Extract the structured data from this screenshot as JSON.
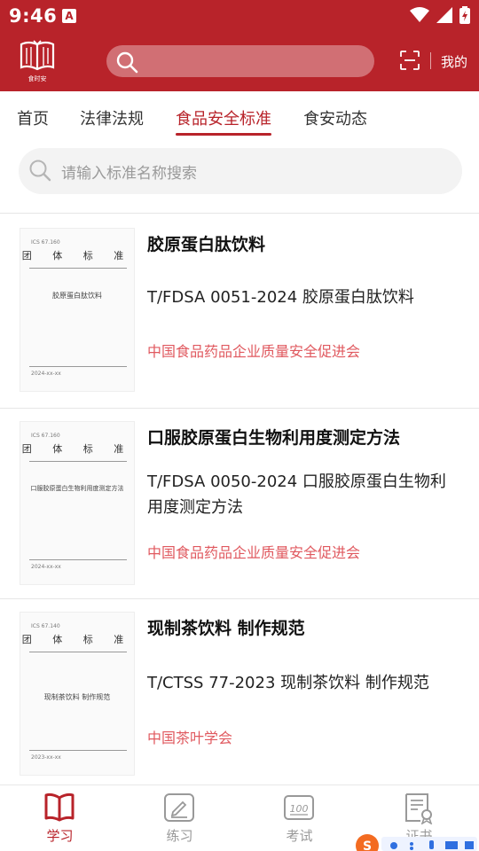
{
  "status_bar": {
    "time": "9:46",
    "notif_letter": "A"
  },
  "header": {
    "logo_label": "食时安",
    "search_placeholder": "",
    "mine_label": "我的"
  },
  "tabs": [
    {
      "label": "首页"
    },
    {
      "label": "法律法规"
    },
    {
      "label": "食品安全标准",
      "active": true
    },
    {
      "label": "食安动态"
    }
  ],
  "search": {
    "placeholder": "请输入标准名称搜索"
  },
  "items": [
    {
      "title": "胶原蛋白肽饮料",
      "code": "T/FDSA 0051-2024 胶原蛋白肽饮料",
      "org": "中国食品药品企业质量安全促进会",
      "thumb_heading": "团 体 标 准",
      "thumb_doc": "胶原蛋白肽饮料"
    },
    {
      "title": "口服胶原蛋白生物利用度测定方法",
      "code": "T/FDSA 0050-2024 口服胶原蛋白生物利用度测定方法",
      "org": "中国食品药品企业质量安全促进会",
      "thumb_heading": "团 体 标 准",
      "thumb_doc": "口服胶原蛋白生物利用度测定方法"
    },
    {
      "title": "现制茶饮料 制作规范",
      "code": "T/CTSS 77-2023 现制茶饮料 制作规范",
      "org": "中国茶叶学会",
      "thumb_heading": "团 体 标 准",
      "thumb_doc": "现制茶饮料 制作规范"
    }
  ],
  "bottom_nav": [
    {
      "label": "学习",
      "icon": "book-icon",
      "active": true
    },
    {
      "label": "练习",
      "icon": "edit-icon"
    },
    {
      "label": "考试",
      "icon": "score-100-icon"
    },
    {
      "label": "证书",
      "icon": "certificate-icon"
    }
  ],
  "colors": {
    "brand": "#b8232a",
    "org_text": "#e0595f"
  }
}
